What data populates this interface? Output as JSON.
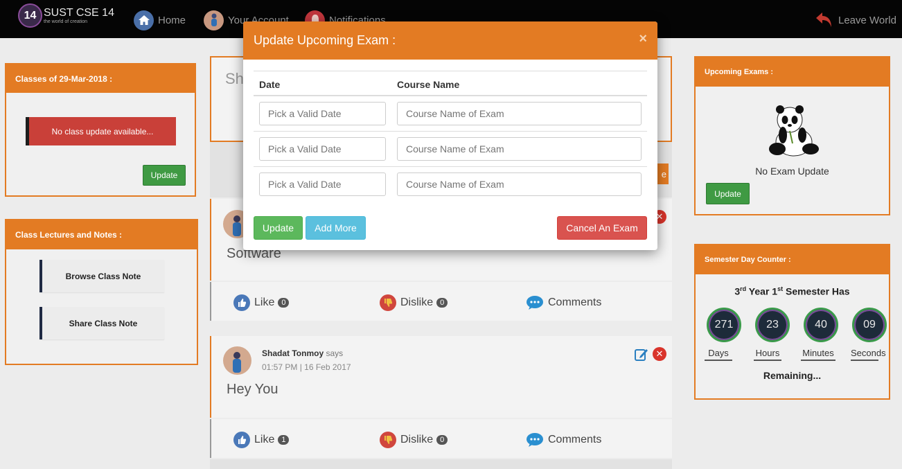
{
  "nav": {
    "brand_number": "14",
    "brand_title": "SUST CSE 14",
    "brand_subtitle": "the world of creation",
    "home": "Home",
    "account": "Your Account",
    "notifications": "Notifications",
    "leave": "Leave World"
  },
  "classes_panel": {
    "title": "Classes of 29-Mar-2018 :",
    "message": "No class update available...",
    "update_label": "Update"
  },
  "lectures_panel": {
    "title": "Class Lectures and Notes :",
    "browse_label": "Browse Class Note",
    "share_label": "Share Class Note"
  },
  "exams_panel": {
    "title": "Upcoming Exams :",
    "message": "No Exam Update",
    "update_label": "Update"
  },
  "counter_panel": {
    "title": "Semester Day Counter :",
    "heading_year": "3",
    "heading_year_sup": "rd",
    "heading_mid": " Year 1",
    "heading_sem_sup": "st",
    "heading_end": " Semester Has",
    "values": {
      "days": "271",
      "hours": "23",
      "minutes": "40",
      "seconds": "09"
    },
    "labels": {
      "days": "Days",
      "hours": "Hours",
      "minutes": "Minutes",
      "seconds": "Seconds"
    },
    "remaining": "Remaining..."
  },
  "feed": {
    "share_prefix": "Sh",
    "post_a": {
      "text": "Software",
      "like_label": "Like",
      "like_count": "0",
      "dislike_label": "Dislike",
      "dislike_count": "0",
      "comments_label": "Comments"
    },
    "post_b": {
      "author": "Shadat Tonmoy",
      "says": "says",
      "time": "01:57 PM | 16 Feb 2017",
      "text": "Hey You",
      "like_label": "Like",
      "like_count": "1",
      "dislike_label": "Dislike",
      "dislike_count": "0",
      "comments_label": "Comments"
    }
  },
  "modal": {
    "title": "Update Upcoming Exam :",
    "close": "×",
    "col_date": "Date",
    "col_course": "Course Name",
    "date_placeholder": "Pick a Valid Date",
    "course_placeholder": "Course Name of Exam",
    "update_label": "Update",
    "add_more_label": "Add More",
    "cancel_label": "Cancel An Exam"
  },
  "colors": {
    "accent": "#e37b23",
    "success": "#5cb85c",
    "info": "#5bc0de",
    "danger": "#d9534f"
  }
}
